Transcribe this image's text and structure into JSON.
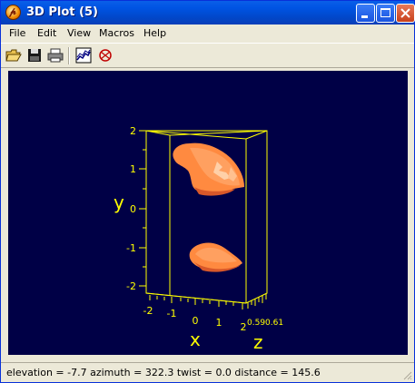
{
  "window": {
    "title": "3D Plot (5)"
  },
  "menu": {
    "items": [
      "File",
      "Edit",
      "View",
      "Macros",
      "Help"
    ]
  },
  "toolbar": {
    "tools": [
      "open-folder-icon",
      "save-icon",
      "print-icon",
      "surface-plot-icon",
      "rotate-plot-icon"
    ]
  },
  "plot": {
    "y_axis": {
      "label": "y",
      "ticks": [
        "2",
        "1",
        "0",
        "-1",
        "-2"
      ]
    },
    "x_axis": {
      "label": "x",
      "ticks": [
        "-2",
        "-1",
        "0",
        "1",
        "2"
      ]
    },
    "z_axis": {
      "label": "z",
      "tick_text": "0.590.61"
    },
    "colors": {
      "background": "#000046",
      "axes": "#ffff00",
      "surface": "#ff8040"
    }
  },
  "status": {
    "text": "elevation = -7.7 azimuth = 322.3 twist = 0.0 distance = 145.6"
  }
}
